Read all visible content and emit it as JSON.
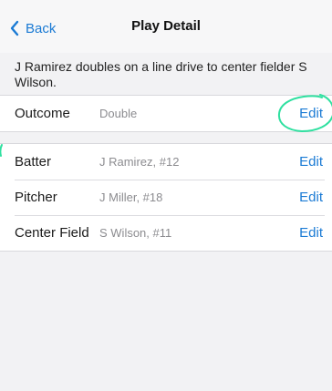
{
  "nav": {
    "back_label": "Back",
    "title": "Play Detail"
  },
  "description": "J Ramirez doubles on a line drive to center fielder S Wilson.",
  "outcome": {
    "label": "Outcome",
    "value": "Double",
    "edit_label": "Edit"
  },
  "players": [
    {
      "label": "Batter",
      "value": "J Ramirez, #12",
      "edit_label": "Edit"
    },
    {
      "label": "Pitcher",
      "value": "J Miller, #18",
      "edit_label": "Edit"
    },
    {
      "label": "Center Field",
      "value": "S Wilson, #11",
      "edit_label": "Edit"
    }
  ],
  "colors": {
    "accent": "#1a7ad4",
    "highlight": "#2fe0a0",
    "background": "#f2f2f4"
  },
  "icons": {
    "back": "chevron-left-icon"
  }
}
